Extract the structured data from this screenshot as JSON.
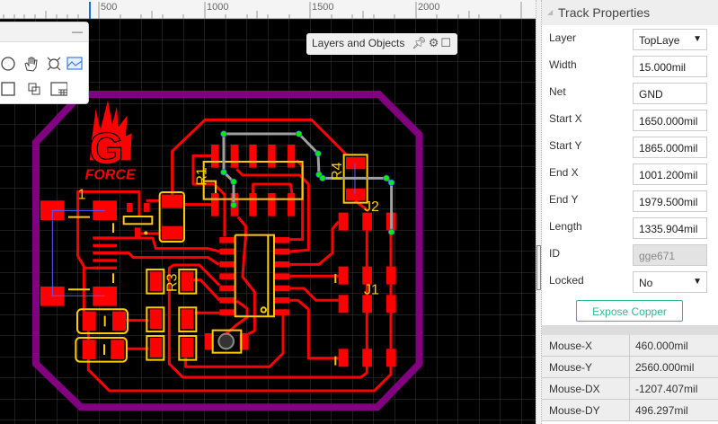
{
  "ruler": {
    "ticks": [
      "500",
      "1000",
      "1500",
      "2000"
    ]
  },
  "toolbox": {
    "minimize_label": "—",
    "tools": [
      "circle-tool",
      "pan-tool",
      "crosshair-tool",
      "image-tool",
      "rectangle-tool",
      "group-tool",
      "table-tool"
    ]
  },
  "layers_panel": {
    "title": "Layers and Objects"
  },
  "pcb": {
    "logo": {
      "text_g": "G",
      "text_force": "FORCE"
    },
    "labels": {
      "r1": "R1",
      "r3": "R3",
      "r4": "R4",
      "j1": "J1",
      "j2": "J2",
      "pin1": "1"
    },
    "colors": {
      "board_outline": "#800080",
      "top_copper": "#ff0000",
      "silkscreen": "#ffcc00",
      "selected_track": "#a0a0a0",
      "handle": "#00ff00",
      "grid": "#3a3a3a"
    }
  },
  "properties": {
    "title": "Track Properties",
    "fields": [
      {
        "label": "Layer",
        "value": "TopLaye",
        "type": "select"
      },
      {
        "label": "Width",
        "value": "15.000mil"
      },
      {
        "label": "Net",
        "value": "GND"
      },
      {
        "label": "Start X",
        "value": "1650.000mil"
      },
      {
        "label": "Start Y",
        "value": "1865.000mil"
      },
      {
        "label": "End X",
        "value": "1001.200mil"
      },
      {
        "label": "End Y",
        "value": "1979.500mil"
      },
      {
        "label": "Length",
        "value": "1335.904mil"
      },
      {
        "label": "ID",
        "value": "gge671",
        "disabled": true
      },
      {
        "label": "Locked",
        "value": "No",
        "type": "select"
      }
    ],
    "expose_copper": "Expose Copper"
  },
  "mouse": [
    {
      "label": "Mouse-X",
      "value": "460.000mil"
    },
    {
      "label": "Mouse-Y",
      "value": "2560.000mil"
    },
    {
      "label": "Mouse-DX",
      "value": "-1207.407mil"
    },
    {
      "label": "Mouse-DY",
      "value": "496.297mil"
    }
  ]
}
